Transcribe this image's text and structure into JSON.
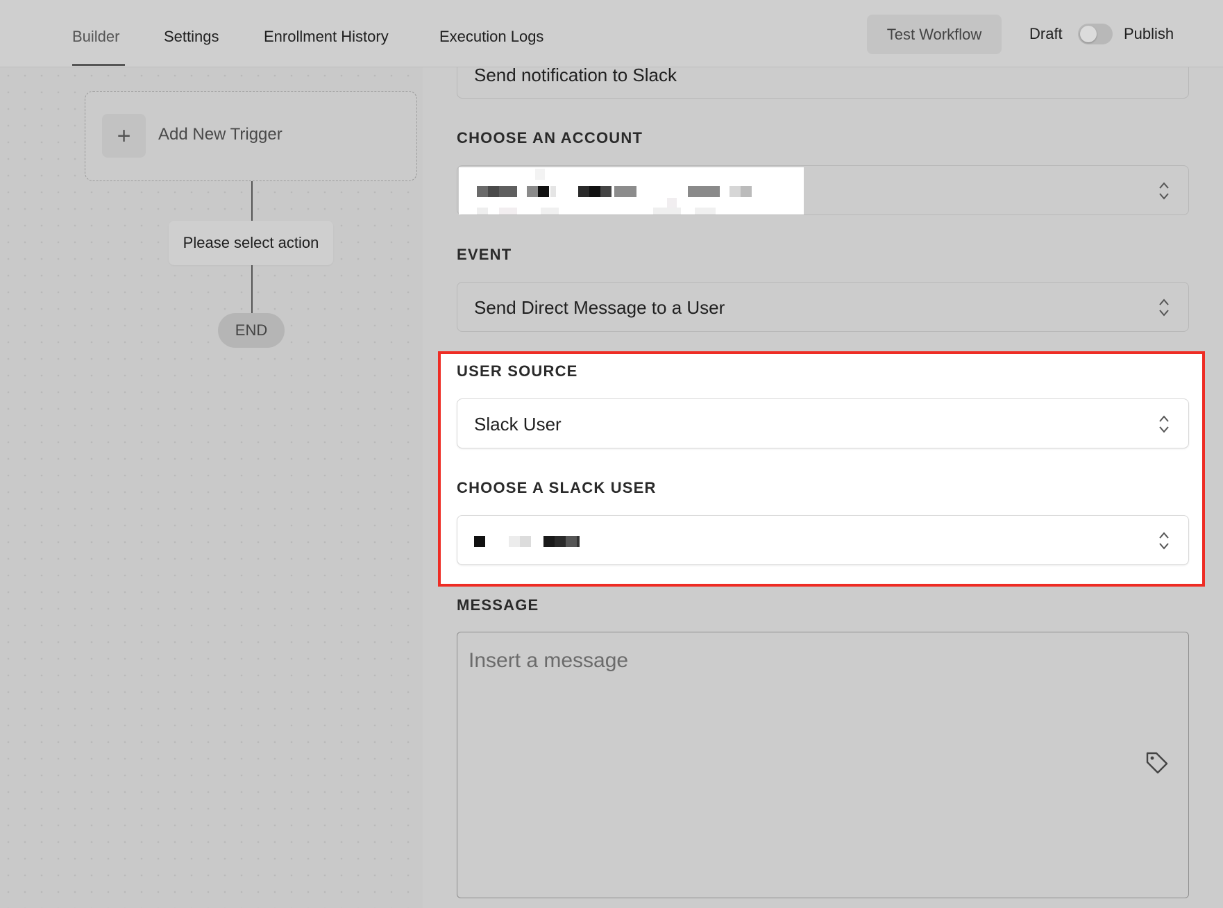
{
  "tabs": {
    "builder": "Builder",
    "settings": "Settings",
    "enrollment_history": "Enrollment History",
    "execution_logs": "Execution Logs",
    "active": "Builder"
  },
  "header": {
    "test_button": "Test Workflow",
    "draft_label": "Draft",
    "publish_label": "Publish",
    "publish_toggle_on": false
  },
  "canvas": {
    "trigger_label": "Add New Trigger",
    "trigger_icon": "plus-icon",
    "action_label": "Please select action",
    "end_label": "END"
  },
  "form": {
    "action_name_value": "Send notification to Slack",
    "account_label": "CHOOSE AN ACCOUNT",
    "account_value": "[redacted]",
    "event_label": "EVENT",
    "event_value": "Send Direct Message to a User",
    "user_source_label": "USER SOURCE",
    "user_source_value": "Slack User",
    "slack_user_label": "CHOOSE A SLACK USER",
    "slack_user_value": "[redacted]",
    "message_label": "MESSAGE",
    "message_placeholder": "Insert a message",
    "message_tag_icon": "tag-icon"
  },
  "colors": {
    "highlight_border": "#ee2c24",
    "background": "#cccccc"
  }
}
